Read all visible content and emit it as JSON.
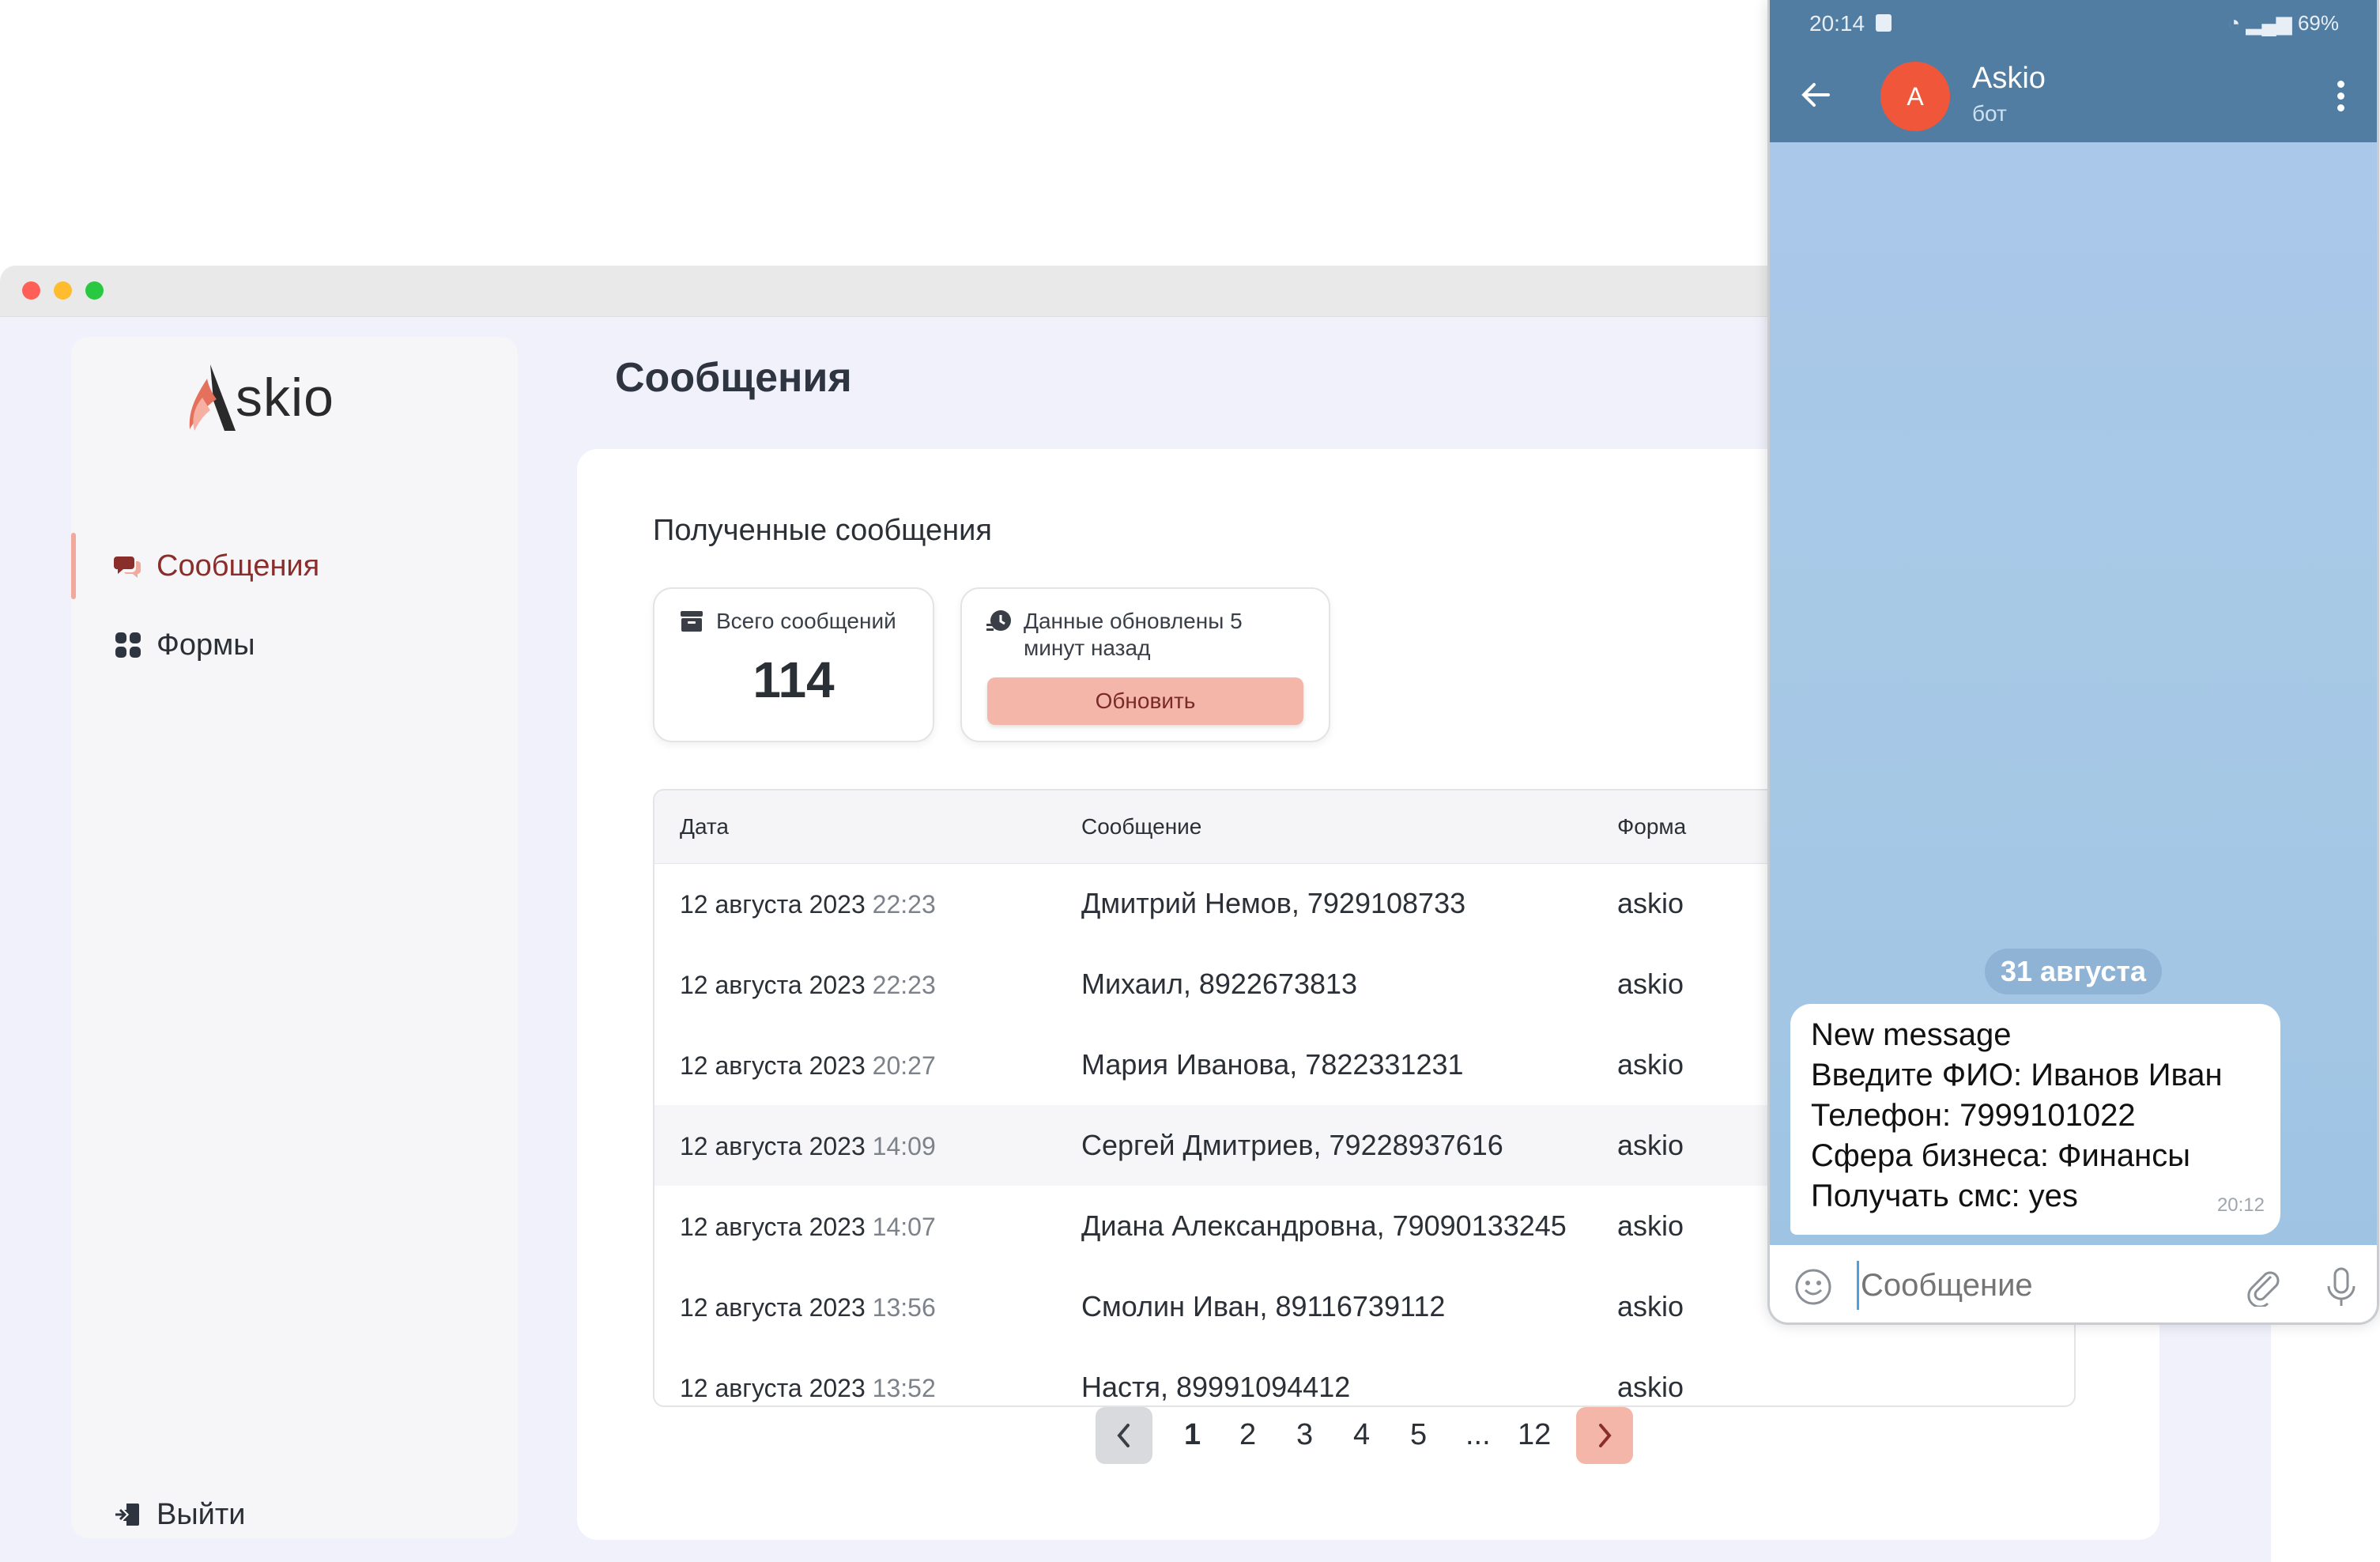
{
  "app": {
    "logo_text": "skio",
    "page_title": "Сообщения"
  },
  "sidebar": {
    "items": [
      {
        "label": "Сообщения",
        "icon": "chat-bubbles-icon",
        "active": true
      },
      {
        "label": "Формы",
        "icon": "grid-icon",
        "active": false
      }
    ],
    "logout_label": "Выйти"
  },
  "main": {
    "section_title": "Полученные сообщения",
    "stats": {
      "total_label": "Всего сообщений",
      "total_value": "114",
      "update_label": "Данные обновлены 5 минут назад",
      "refresh_label": "Обновить"
    },
    "table": {
      "headers": [
        "Дата",
        "Сообщение",
        "Форма"
      ],
      "rows": [
        {
          "date": "12 августа 2023",
          "time": "22:23",
          "message": "Дмитрий Немов, 7929108733",
          "form": "askio"
        },
        {
          "date": "12 августа 2023",
          "time": "22:23",
          "message": "Михаил, 8922673813",
          "form": "askio"
        },
        {
          "date": "12 августа 2023",
          "time": "20:27",
          "message": "Мария Иванова, 7822331231",
          "form": "askio"
        },
        {
          "date": "12 августа 2023",
          "time": "14:09",
          "message": "Сергей Дмитриев, 79228937616",
          "form": "askio"
        },
        {
          "date": "12 августа 2023",
          "time": "14:07",
          "message": "Диана Александровна, 79090133245",
          "form": "askio"
        },
        {
          "date": "12 августа 2023",
          "time": "13:56",
          "message": "Смолин Иван, 89116739112",
          "form": "askio"
        },
        {
          "date": "12 августа 2023",
          "time": "13:52",
          "message": "Настя, 89991094412",
          "form": "askio"
        }
      ]
    },
    "pagination": {
      "pages": [
        "1",
        "2",
        "3",
        "4",
        "5",
        "...",
        "12"
      ],
      "current": "1"
    }
  },
  "phone": {
    "status_time": "20:14",
    "status_battery": "69%",
    "chat_name": "Askio",
    "chat_subtitle": "бот",
    "avatar_letter": "A",
    "date_chip": "31 августа",
    "message_lines": [
      "New message",
      "Введите ФИО: Иванов Иван",
      "Телефон: 7999101022",
      "Сфера бизнеса: Финансы",
      "Получать смс: yes"
    ],
    "message_time": "20:12",
    "input_placeholder": "Сообщение"
  },
  "colors": {
    "accent": "#f3b6a9",
    "accent_text": "#8a2e2c",
    "telegram_header": "#517da2",
    "avatar": "#f0563a"
  }
}
